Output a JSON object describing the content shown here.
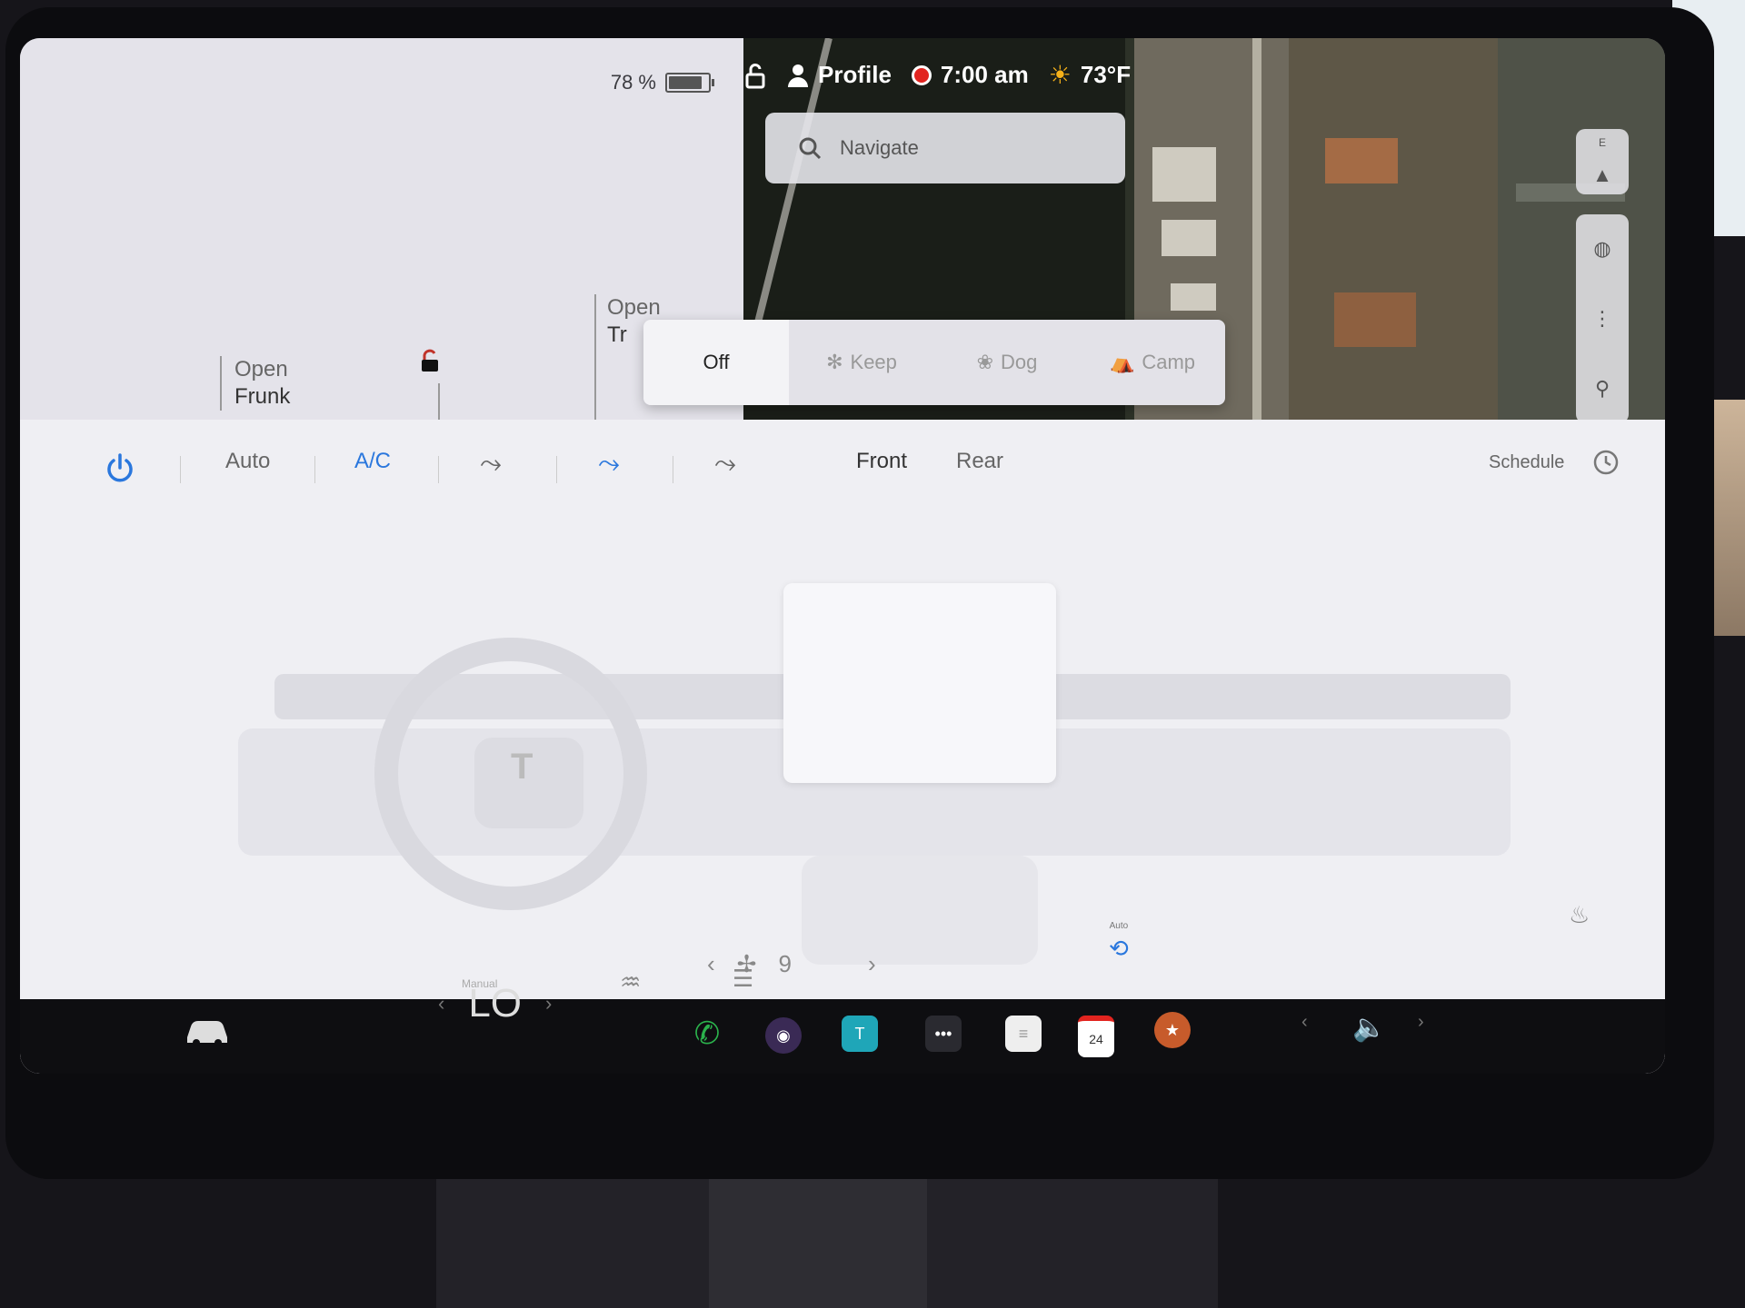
{
  "status": {
    "battery_percent": "78 %",
    "battery_level": 0.78,
    "profile_label": "Profile",
    "time": "7:00 am",
    "temperature": "73°F"
  },
  "car": {
    "frunk_line1": "Open",
    "frunk_line2": "Frunk",
    "trunk_line1": "Open",
    "trunk_line2": "Tr"
  },
  "map": {
    "search_placeholder": "Navigate",
    "compass_label": "E"
  },
  "modes": {
    "items": [
      {
        "label": "Off",
        "active": true
      },
      {
        "label": "Keep",
        "active": false
      },
      {
        "label": "Dog",
        "active": false
      },
      {
        "label": "Camp",
        "active": false
      }
    ]
  },
  "climate": {
    "auto_label": "Auto",
    "ac_label": "A/C",
    "front_label": "Front",
    "rear_label": "Rear",
    "schedule_label": "Schedule",
    "fan_speed": "9",
    "recirc_label": "Auto"
  },
  "taskbar": {
    "temp_mode": "Manual",
    "temp_value": "LO",
    "calendar_day": "24"
  },
  "colors": {
    "accent": "#2a77dd",
    "record": "#e2241f",
    "phone": "#2bb24c"
  }
}
